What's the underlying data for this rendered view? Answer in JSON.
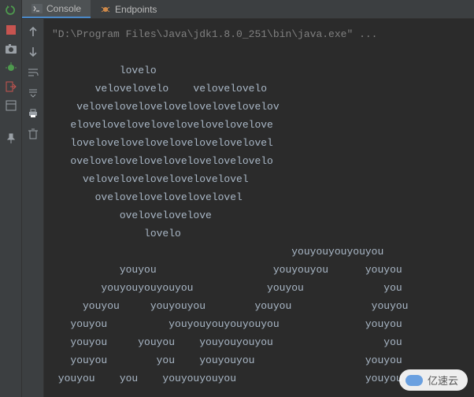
{
  "tabs": {
    "console_label": "Console",
    "endpoints_label": "Endpoints"
  },
  "console": {
    "command": "\"D:\\Program Files\\Java\\jdk1.8.0_251\\bin\\java.exe\" ...",
    "lines": [
      "",
      "           lovelo",
      "       velovelovelo    velovelovelo",
      "    velovelovelovelovelovelovelovelov",
      "   elovelovelovelovelovelovelovelove",
      "   lovelovelovelovelovelovelovelovel",
      "   ovelovelovelovelovelovelovelovelo",
      "     velovelovelovelovelovelovel",
      "       ovelovelovelovelovelovel",
      "           ovelovelovelove",
      "               lovelo",
      "                                       youyouyouyouyou",
      "           youyou                   youyouyou      youyou",
      "        youyouyouyouyou            youyou             you",
      "     youyou     youyouyou        youyou             youyou",
      "   youyou          youyouyouyouyouyou              youyou",
      "   youyou     youyou    youyouyouyou                  you",
      "   youyou        you    youyouyou                  youyou",
      " youyou    you    youyouyouyou                     youyou"
    ]
  },
  "watermark": {
    "text": "亿速云"
  },
  "icons": {
    "rerun": "rerun",
    "stop": "stop",
    "camera": "camera",
    "bug": "bug",
    "exit": "exit",
    "layout": "layout",
    "pin": "pin",
    "up": "up",
    "down": "down",
    "wrap": "wrap",
    "scroll": "scroll",
    "print": "print",
    "trash": "trash",
    "terminal": "terminal",
    "spider": "spider"
  }
}
